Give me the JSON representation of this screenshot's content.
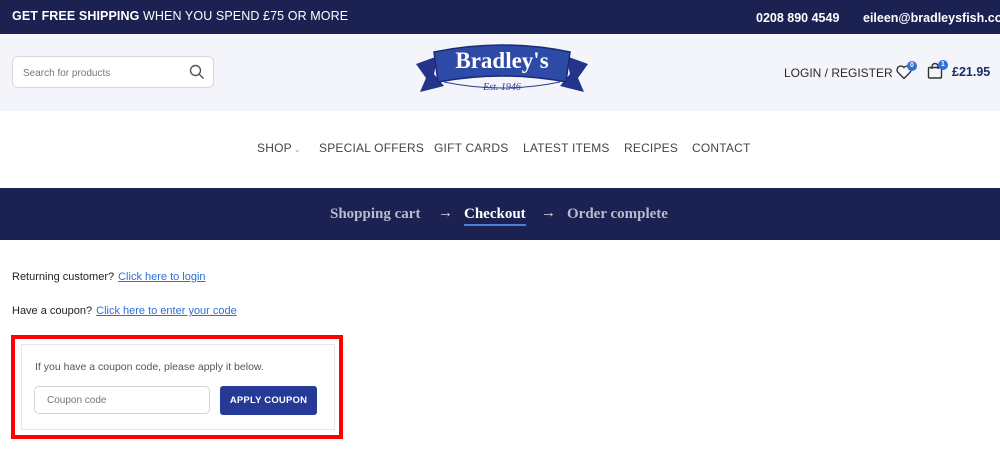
{
  "topbar": {
    "promo_bold": "GET FREE SHIPPING",
    "promo_rest": " WHEN YOU SPEND £75 OR MORE",
    "phone": "0208 890 4549",
    "email": "eileen@bradleysfish.com"
  },
  "header": {
    "search_placeholder": "Search for products",
    "logo_text": "Bradley's",
    "logo_sub": "Est. 1946",
    "login_label": "LOGIN / REGISTER",
    "wishlist_count": "0",
    "cart_count": "1",
    "cart_total": "£21.95"
  },
  "nav": {
    "items": [
      "SHOP",
      "SPECIAL OFFERS",
      "GIFT CARDS",
      "LATEST ITEMS",
      "RECIPES",
      "CONTACT"
    ]
  },
  "steps": {
    "items": [
      "Shopping cart",
      "Checkout",
      "Order complete"
    ],
    "arrow": "→"
  },
  "notices": {
    "returning_text": "Returning customer?",
    "returning_link": "Click here to login",
    "coupon_text": "Have a coupon?",
    "coupon_link": "Click here to enter your code"
  },
  "coupon": {
    "message": "If you have a coupon code, please apply it below.",
    "placeholder": "Coupon code",
    "button_label": "APPLY COUPON"
  },
  "colors": {
    "navy": "#1b2150",
    "button_blue": "#253a96",
    "link_blue": "#2f6fd6",
    "highlight_red": "#ff0000"
  }
}
